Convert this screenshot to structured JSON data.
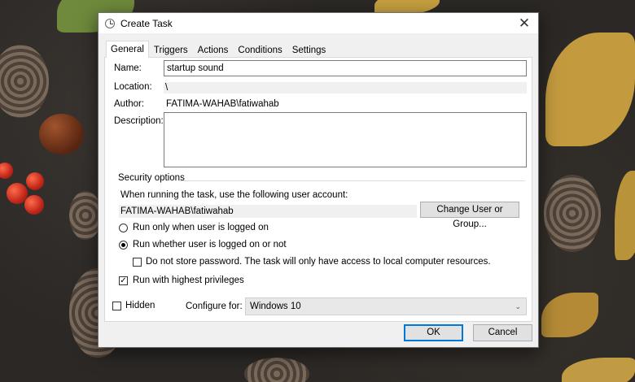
{
  "window": {
    "title": "Create Task"
  },
  "tabs": [
    {
      "label": "General",
      "active": true
    },
    {
      "label": "Triggers",
      "active": false
    },
    {
      "label": "Actions",
      "active": false
    },
    {
      "label": "Conditions",
      "active": false
    },
    {
      "label": "Settings",
      "active": false
    }
  ],
  "general": {
    "name_label": "Name:",
    "name_value": "startup sound",
    "location_label": "Location:",
    "location_value": "\\",
    "author_label": "Author:",
    "author_value": "FATIMA-WAHAB\\fatiwahab",
    "description_label": "Description:",
    "description_value": ""
  },
  "security": {
    "heading": "Security options",
    "account_prompt": "When running the task, use the following user account:",
    "account_value": "FATIMA-WAHAB\\fatiwahab",
    "change_button": "Change User or Group...",
    "radio_logged_on": "Run only when user is logged on",
    "radio_whether": "Run whether user is logged on or not",
    "radio_selected": "whether",
    "no_store_password": "Do not store password.  The task will only have access to local computer resources.",
    "no_store_password_checked": false,
    "highest_privileges": "Run with highest privileges",
    "highest_privileges_checked": true
  },
  "footer": {
    "hidden_label": "Hidden",
    "hidden_checked": false,
    "configure_label": "Configure for:",
    "configure_value": "Windows 10",
    "ok_button": "OK",
    "cancel_button": "Cancel"
  },
  "colors": {
    "accent": "#0078d7",
    "dialog_bg": "#f0f0f0"
  }
}
